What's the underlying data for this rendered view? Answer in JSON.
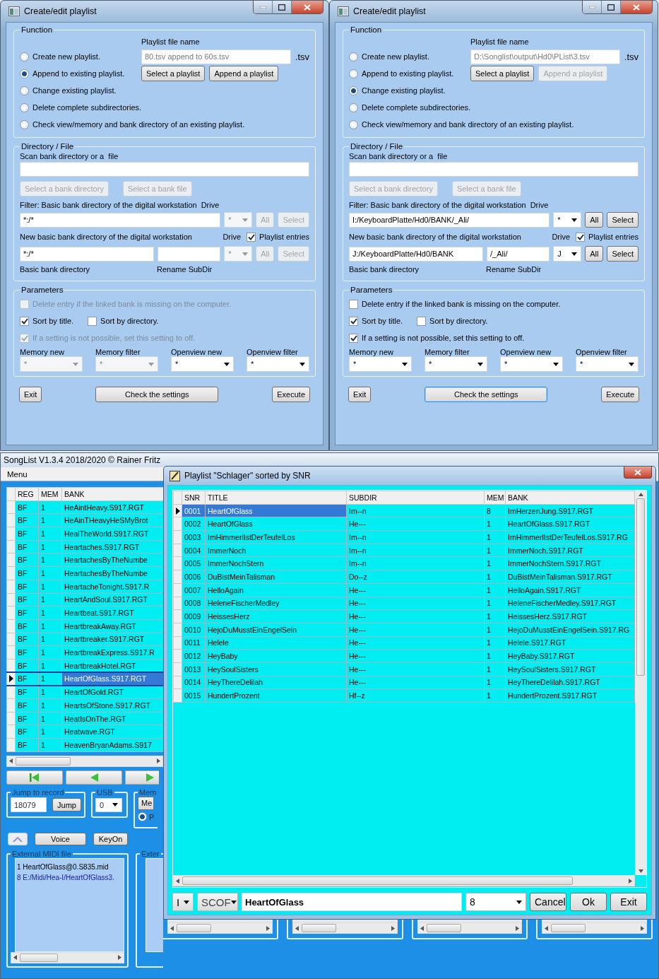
{
  "dialogs": [
    {
      "title": "Create/edit playlist",
      "function_group": {
        "legend": "Function",
        "file_label": "Playlist file name",
        "file_value": "80.tsv append to 60s.tsv",
        "extension": ".tsv",
        "options": [
          {
            "label": "Create new playlist.",
            "selected": false
          },
          {
            "label": "Append to existing playlist.",
            "selected": true
          },
          {
            "label": "Change existing playlist.",
            "selected": false
          },
          {
            "label": "Delete complete subdirectories.",
            "selected": false
          },
          {
            "label": "Check view/memory and bank directory of an existing playlist.",
            "selected": false
          }
        ],
        "buttons": [
          {
            "label": "Select a playlist",
            "disabled": false
          },
          {
            "label": "Append a playlist",
            "disabled": false
          }
        ]
      },
      "directory_group": {
        "legend": "Directory / File",
        "scan_label": "Scan bank directory or a  file",
        "buttons": [
          {
            "label": "Select a bank directory",
            "disabled": true
          },
          {
            "label": "Select a bank file",
            "disabled": true
          }
        ],
        "filter_label": "Filter: Basic bank directory of the digital workstation",
        "filter_drive_label": "Drive",
        "filter_value": "*:/*",
        "filter_drive": {
          "value": "*",
          "disabled": true
        },
        "filter_buttons": [
          {
            "label": "All",
            "disabled": true
          },
          {
            "label": "Select",
            "disabled": true
          }
        ],
        "new_label": "New basic bank directory of the digital workstation",
        "new_drive_label": "Drive",
        "playlist_entries": {
          "label": "Playlist entries",
          "checked": true
        },
        "new_value": "*:/*",
        "new_drive": {
          "value": "*",
          "disabled": true
        },
        "new_buttons": [
          {
            "label": "All",
            "disabled": true
          },
          {
            "label": "Select",
            "disabled": true
          }
        ],
        "base_caption": "Basic bank directory",
        "rename_caption": "Rename SubDir"
      },
      "parameters_group": {
        "legend": "Parameters",
        "rows": [
          {
            "checks": [
              {
                "label": "Delete entry if the linked bank is missing on the computer.",
                "checked": false,
                "disabled": true
              }
            ]
          },
          {
            "checks": [
              {
                "label": "Sort by title.",
                "checked": true,
                "disabled": false
              },
              {
                "label": "Sort by directory.",
                "checked": false,
                "disabled": false
              }
            ]
          },
          {
            "checks": [
              {
                "label": "If a setting is not possible, set this setting to off.",
                "checked": true,
                "disabled": true
              }
            ]
          }
        ],
        "selects": [
          {
            "label": "Memory new",
            "value": "*",
            "disabled": true
          },
          {
            "label": "Memory filter",
            "value": "*",
            "disabled": true
          },
          {
            "label": "Openview new",
            "value": "*",
            "disabled": false
          },
          {
            "label": "Openview filter",
            "value": "*",
            "disabled": false
          }
        ]
      },
      "footer_buttons": [
        {
          "label": "Exit",
          "focused": false
        },
        {
          "label": "Check the settings",
          "focused": false
        },
        {
          "label": "Execute",
          "focused": false
        }
      ]
    },
    {
      "title": "Create/edit playlist",
      "function_group": {
        "legend": "Function",
        "file_label": "Playlist file name",
        "file_value": "D:\\Songlist\\output\\Hd0\\PList\\3.tsv",
        "extension": ".tsv",
        "options": [
          {
            "label": "Create new playlist.",
            "selected": false
          },
          {
            "label": "Append to existing playlist.",
            "selected": false
          },
          {
            "label": "Change existing playlist.",
            "selected": true
          },
          {
            "label": "Delete complete subdirectories.",
            "selected": false
          },
          {
            "label": "Check view/memory and bank directory of an existing playlist.",
            "selected": false
          }
        ],
        "buttons": [
          {
            "label": "Select a playlist",
            "disabled": false
          },
          {
            "label": "Append a playlist",
            "disabled": true
          }
        ]
      },
      "directory_group": {
        "legend": "Directory / File",
        "scan_label": "Scan bank directory or a  file",
        "buttons": [
          {
            "label": "Select a bank directory",
            "disabled": true
          },
          {
            "label": "Select a bank file",
            "disabled": true
          }
        ],
        "filter_label": "Filter: Basic bank directory of the digital workstation",
        "filter_drive_label": "Drive",
        "filter_value": "I:/KeyboardPlatte/Hd0/BANK/_Ali/",
        "filter_drive": {
          "value": "*",
          "disabled": false
        },
        "filter_buttons": [
          {
            "label": "All",
            "disabled": false
          },
          {
            "label": "Select",
            "disabled": false
          }
        ],
        "new_label": "New basic bank directory of the digital workstation",
        "new_drive_label": "Drive",
        "playlist_entries": {
          "label": "Playlist entries",
          "checked": true
        },
        "new_value": "J:/KeyboardPlatte/Hd0/BANK",
        "rename_value": "/_Ali/",
        "new_drive": {
          "value": "J",
          "disabled": false
        },
        "new_buttons": [
          {
            "label": "All",
            "disabled": false
          },
          {
            "label": "Select",
            "disabled": false
          }
        ],
        "base_caption": "Basic bank directory",
        "rename_caption": "Rename SubDir"
      },
      "parameters_group": {
        "legend": "Parameters",
        "rows": [
          {
            "checks": [
              {
                "label": "Delete entry if the linked bank is missing on the computer.",
                "checked": false,
                "disabled": false
              }
            ]
          },
          {
            "checks": [
              {
                "label": "Sort by title.",
                "checked": true,
                "disabled": false
              },
              {
                "label": "Sort by directory.",
                "checked": false,
                "disabled": false
              }
            ]
          },
          {
            "checks": [
              {
                "label": "If a setting is not possible, set this setting to off.",
                "checked": true,
                "disabled": false
              }
            ]
          }
        ],
        "selects": [
          {
            "label": "Memory new",
            "value": "*",
            "disabled": false
          },
          {
            "label": "Memory filter",
            "value": "*",
            "disabled": false
          },
          {
            "label": "Openview new",
            "value": "*",
            "disabled": false
          },
          {
            "label": "Openview filter",
            "value": "*",
            "disabled": false
          }
        ]
      },
      "footer_buttons": [
        {
          "label": "Exit",
          "focused": false
        },
        {
          "label": "Check the settings",
          "focused": true
        },
        {
          "label": "Execute",
          "focused": false
        }
      ]
    }
  ],
  "main_window": {
    "title": "SongList V1.3.4 2018/2020 © Rainer Fritz",
    "menu": "Menu",
    "bank_table": {
      "columns": [
        "REG",
        "MEM",
        "BANK"
      ],
      "rows": [
        {
          "cells": [
            "BF",
            "1",
            "HeAintHeavy.S917.RGT"
          ],
          "selected": false
        },
        {
          "cells": [
            "BF",
            "1",
            "HeAinTHeavyHeSMyBrot"
          ],
          "selected": false
        },
        {
          "cells": [
            "BF",
            "1",
            "HealTheWorld.S917.RGT"
          ],
          "selected": false
        },
        {
          "cells": [
            "BF",
            "1",
            "Heartaches.S917.RGT"
          ],
          "selected": false
        },
        {
          "cells": [
            "BF",
            "1",
            "HeartachesByTheNumbe"
          ],
          "selected": false
        },
        {
          "cells": [
            "BF",
            "1",
            "HeartachesByTheNumbe"
          ],
          "selected": false
        },
        {
          "cells": [
            "BF",
            "1",
            "HeartacheTonight.S917.R"
          ],
          "selected": false
        },
        {
          "cells": [
            "BF",
            "1",
            "HeartAndSoul.S917.RGT"
          ],
          "selected": false
        },
        {
          "cells": [
            "BF",
            "1",
            "Heartbeat.S917.RGT"
          ],
          "selected": false
        },
        {
          "cells": [
            "BF",
            "1",
            "HeartbreakAway.RGT"
          ],
          "selected": false
        },
        {
          "cells": [
            "BF",
            "1",
            "Heartbreaker.S917.RGT"
          ],
          "selected": false
        },
        {
          "cells": [
            "BF",
            "1",
            "HeartbreakExpress.S917.R"
          ],
          "selected": false
        },
        {
          "cells": [
            "BF",
            "1",
            "HeartbreakHotel.RGT"
          ],
          "selected": false
        },
        {
          "cells": [
            "BF",
            "1",
            "HeartOfGlass.S917.RGT"
          ],
          "selected": true
        },
        {
          "cells": [
            "BF",
            "1",
            "HeartOfGold.RGT"
          ],
          "selected": false
        },
        {
          "cells": [
            "BF",
            "1",
            "HeartsOfStone.S917.RGT"
          ],
          "selected": false
        },
        {
          "cells": [
            "BF",
            "1",
            "HeatIsOnThe.RGT"
          ],
          "selected": false
        },
        {
          "cells": [
            "BF",
            "1",
            "Heatwave.RGT"
          ],
          "selected": false
        },
        {
          "cells": [
            "BF",
            "1",
            "HeavenBryanAdams.S917"
          ],
          "selected": false
        }
      ]
    },
    "jump_group": {
      "legend": "Jump to record",
      "value": "18079",
      "button": "Jump"
    },
    "usb_group": {
      "legend": "USB",
      "value": "0"
    },
    "memory_group": {
      "legend": "Mem",
      "button": "Me",
      "radio": {
        "label": "P",
        "selected": true
      }
    },
    "action_buttons": [
      "Voice",
      "KeyOn"
    ],
    "midi_group": {
      "legend": "External MIDI file",
      "items": [
        {
          "text": "1 HeartOfGlass@0.S835.mid",
          "kind": "file"
        },
        {
          "text": "8 E:/Midi/Hea-I/HeartOfGlass3.",
          "kind": "path"
        }
      ]
    },
    "external_group": {
      "legend": "Exter"
    }
  },
  "playlist_window": {
    "title": "Playlist \"Schlager\" sorted by SNR",
    "columns": [
      "SNR",
      "TITLE",
      "SUBDIR",
      "MEM",
      "BANK"
    ],
    "rows": [
      {
        "cells": [
          "0001",
          "HeartOfGlass",
          "Im--n",
          "8",
          "ImHerzenJung.S917.RGT"
        ],
        "selected": true
      },
      {
        "cells": [
          "0002",
          "HeartOfGlass",
          "He---",
          "1",
          "HeartOfGlass.S917.RGT"
        ],
        "selected": false
      },
      {
        "cells": [
          "0003",
          "ImHimmerlIstDerTeufelLos",
          "Im--n",
          "1",
          "ImHimmerlIstDerTeufelLos.S917.RG"
        ],
        "selected": false
      },
      {
        "cells": [
          "0004",
          "ImmerNoch",
          "Im--n",
          "1",
          "ImmerNoch.S917.RGT"
        ],
        "selected": false
      },
      {
        "cells": [
          "0005",
          "ImmerNochStern",
          "Im--n",
          "1",
          "ImmerNochStern.S917.RGT"
        ],
        "selected": false
      },
      {
        "cells": [
          "0006",
          "DuBistMeinTalisman",
          "Do--z",
          "1",
          "DuBistMeinTalisman.S917.RGT"
        ],
        "selected": false
      },
      {
        "cells": [
          "0007",
          "HelloAgain",
          "He---",
          "1",
          "HelloAgain.S917.RGT"
        ],
        "selected": false
      },
      {
        "cells": [
          "0008",
          "HeleneFischerMedley",
          "He---",
          "1",
          "HeleneFischerMedley.S917.RGT"
        ],
        "selected": false
      },
      {
        "cells": [
          "0009",
          "HeissesHerz",
          "He---",
          "1",
          "HeissesHerz.S917.RGT"
        ],
        "selected": false
      },
      {
        "cells": [
          "0010",
          "HejoDuMusstEinEngelSein",
          "He---",
          "1",
          "HejoDuMusstEinEngelSein.S917.RG"
        ],
        "selected": false
      },
      {
        "cells": [
          "0011",
          "Helele",
          "He---",
          "1",
          "Helele.S917.RGT"
        ],
        "selected": false
      },
      {
        "cells": [
          "0012",
          "HeyBaby",
          "He---",
          "1",
          "HeyBaby.S917.RGT"
        ],
        "selected": false
      },
      {
        "cells": [
          "0013",
          "HeySoulSisters",
          "He---",
          "1",
          "HeySoulSisters.S917.RGT"
        ],
        "selected": false
      },
      {
        "cells": [
          "0014",
          "HeyThereDelilah",
          "He---",
          "1",
          "HeyThereDelilah.S917.RGT"
        ],
        "selected": false
      },
      {
        "cells": [
          "0015",
          "HundertProzent",
          "Hf--z",
          "1",
          "HundertProzent.S917.RGT"
        ],
        "selected": false
      }
    ],
    "bottom_bar": {
      "mode": "I",
      "search_type": "SCOF",
      "search_value": "HeartOfGlass",
      "memory": "8",
      "buttons": [
        "Cancel",
        "Ok",
        "Exit"
      ]
    }
  }
}
